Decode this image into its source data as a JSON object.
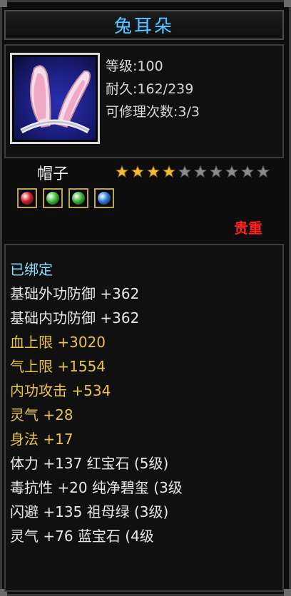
{
  "item": {
    "title": "兔耳朵",
    "level": "等级:100",
    "durability": "耐久:162/239",
    "repairs": "可修理次数:3/3",
    "type": "帽子",
    "stars_filled": 4,
    "stars_total": 10,
    "rarity": "贵重",
    "bound": "已绑定"
  },
  "gems": [
    {
      "name": "red-gem-icon",
      "color": "#d21d2a"
    },
    {
      "name": "green-gem-icon",
      "color": "#3fbf3a"
    },
    {
      "name": "green-gem-icon",
      "color": "#3bb23a"
    },
    {
      "name": "blue-gem-icon",
      "color": "#2a7de0"
    }
  ],
  "attributes": [
    {
      "text": "基础外功防御 +362"
    },
    {
      "text": "基础内功防御 +362"
    },
    {
      "text": "血上限 +3020"
    },
    {
      "text": "气上限 +1554"
    },
    {
      "text": "内功攻击 +534"
    },
    {
      "text": "灵气 +28"
    },
    {
      "text": "身法 +17"
    },
    {
      "text": "体力 +137 红宝石 (5级)"
    },
    {
      "text": "毒抗性 +20 纯净碧玺 (3级"
    },
    {
      "text": "闪避 +135 祖母绿 (3级)"
    },
    {
      "text": "灵气 +76 蓝宝石 (4级"
    }
  ],
  "colors": {
    "title": "#5fc7ff",
    "rarity": "#ff2020",
    "attr_white": "#e8e8e8",
    "attr_gold": "#e8c44a"
  }
}
